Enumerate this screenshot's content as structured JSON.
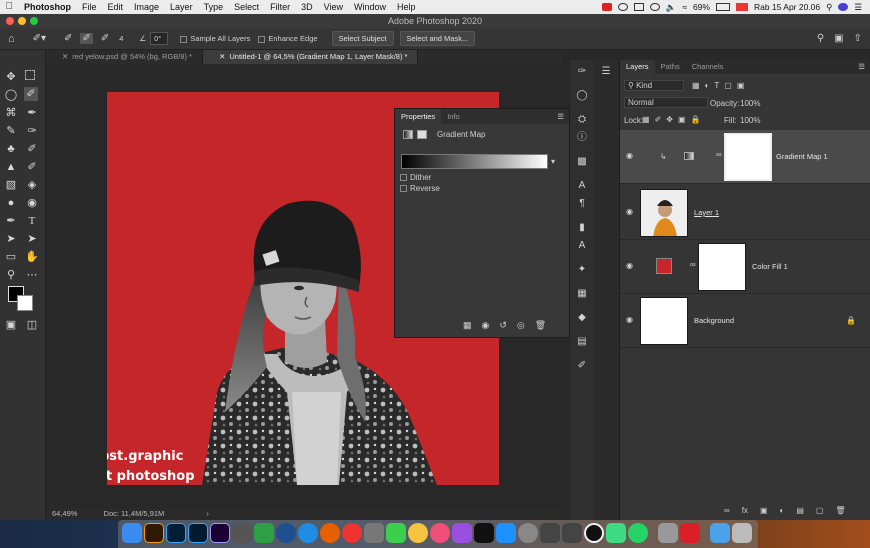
{
  "menubar": {
    "app": "Photoshop",
    "items": [
      "File",
      "Edit",
      "Image",
      "Layer",
      "Type",
      "Select",
      "Filter",
      "3D",
      "View",
      "Window",
      "Help"
    ],
    "battery": "69%",
    "clock": "Rab 15 Apr  20.06"
  },
  "window": {
    "title": "Adobe Photoshop 2020"
  },
  "options": {
    "brush_size": "4",
    "angle": "0°",
    "sample_all_layers": "Sample All Layers",
    "enhance_edge": "Enhance Edge",
    "select_subject": "Select Subject",
    "select_and_mask": "Select and Mask..."
  },
  "doc_tabs": [
    {
      "label": "red yelow.psd @ 54% (bg, RGB/8) *"
    },
    {
      "label": "Untitled-1 @ 64,5% (Gradient Map 1, Layer Mask/8) *"
    }
  ],
  "status": {
    "zoom": "64,49%",
    "doc": "Doc: 11,4M/5,91M"
  },
  "canvas": {
    "background_color": "#c4262a",
    "watermark_instagram": "@pst.graphic",
    "watermark_youtube": "PSt photoshop"
  },
  "properties": {
    "tabs": [
      "Properties",
      "Info"
    ],
    "adjustment": "Gradient Map",
    "dither": "Dither",
    "reverse": "Reverse"
  },
  "layers_panel": {
    "tabs": [
      "Layers",
      "Paths",
      "Channels"
    ],
    "filter": "Kind",
    "blend_mode": "Normal",
    "opacity_label": "Opacity:",
    "opacity": "100%",
    "lock_label": "Lock:",
    "fill_label": "Fill:",
    "fill": "100%",
    "layers": [
      {
        "name": "Gradient Map 1",
        "selected": true
      },
      {
        "name": "Layer 1",
        "selected": false
      },
      {
        "name": "Color Fill 1",
        "selected": false
      },
      {
        "name": "Background",
        "selected": false
      }
    ]
  },
  "colors": {
    "accent_red": "#c4262a",
    "panel_bg": "#353535",
    "selected_layer": "#4a4a4a"
  }
}
